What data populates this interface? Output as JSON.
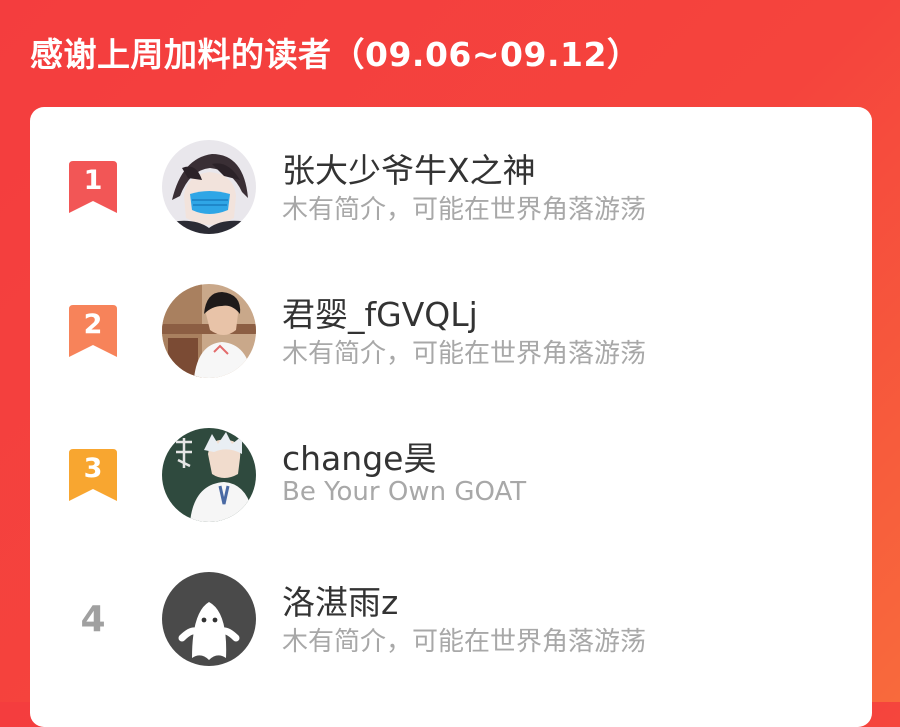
{
  "header": {
    "title": "感谢上周加料的读者（09.06~09.12）"
  },
  "colors": {
    "background_start": "#f43d3e",
    "background_end": "#f86a3c",
    "rank_1": "#f25656",
    "rank_2": "#f7835a",
    "rank_3": "#f8a630",
    "rank_other": "#a0a0a0"
  },
  "readers": [
    {
      "rank": "1",
      "name": "张大少爷牛X之神",
      "intro": "木有简介，可能在世界角落游荡",
      "avatar": "anime-masked-boy-avatar"
    },
    {
      "rank": "2",
      "name": "君婴_fGVQLj",
      "intro": "木有简介，可能在世界角落游荡",
      "avatar": "photo-boy-avatar"
    },
    {
      "rank": "3",
      "name": "change昊",
      "intro": "Be Your Own GOAT",
      "avatar": "anime-teacher-chalkboard-avatar"
    },
    {
      "rank": "4",
      "name": "洛湛雨z",
      "intro": "木有简介，可能在世界角落游荡",
      "avatar": "default-ghost-avatar"
    }
  ]
}
